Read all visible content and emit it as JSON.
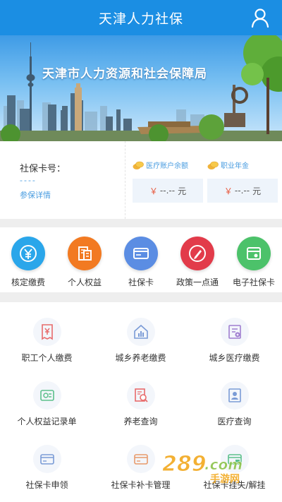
{
  "header": {
    "title": "天津人力社保"
  },
  "banner": {
    "text": "天津市人力资源和社会保障局"
  },
  "card": {
    "number_label": "社保卡号：",
    "number_value": "----",
    "detail_link": "参保详情",
    "medical": {
      "label": "医疗账户余额",
      "yen": "￥",
      "amount": "--.--",
      "unit": "元"
    },
    "annuity": {
      "label": "职业年金",
      "yen": "￥",
      "amount": "--.--",
      "unit": "元"
    }
  },
  "quick": [
    {
      "label": "核定缴费",
      "icon": "yen-coin-icon",
      "color": "#2aa6ea"
    },
    {
      "label": "个人权益",
      "icon": "document-building-icon",
      "color": "#f27a22"
    },
    {
      "label": "社保卡",
      "icon": "id-card-icon",
      "color": "#5b8de3"
    },
    {
      "label": "政策一点通",
      "icon": "pen-icon",
      "color": "#e23b4a"
    },
    {
      "label": "电子社保卡",
      "icon": "e-card-icon",
      "color": "#4cc26a"
    }
  ],
  "grid": [
    {
      "label": "职工个人缴费",
      "icon": "receipt-yen-icon"
    },
    {
      "label": "城乡养老缴费",
      "icon": "house-chart-icon"
    },
    {
      "label": "城乡医疗缴费",
      "icon": "medical-bill-icon"
    },
    {
      "label": "个人权益记录单",
      "icon": "record-card-icon"
    },
    {
      "label": "养老查询",
      "icon": "pension-search-icon"
    },
    {
      "label": "医疗查询",
      "icon": "medical-person-icon"
    },
    {
      "label": "社保卡申领",
      "icon": "card-apply-icon"
    },
    {
      "label": "社保卡补卡管理",
      "icon": "card-reissue-icon"
    },
    {
      "label": "社保卡挂失/解挂",
      "icon": "card-lock-icon"
    }
  ],
  "watermark": {
    "brand": "289",
    "suffix": ".com",
    "sub": "手游网"
  },
  "colors": {
    "primary": "#1b8ee3",
    "link": "#4a9de0",
    "price": "#e8593d"
  }
}
